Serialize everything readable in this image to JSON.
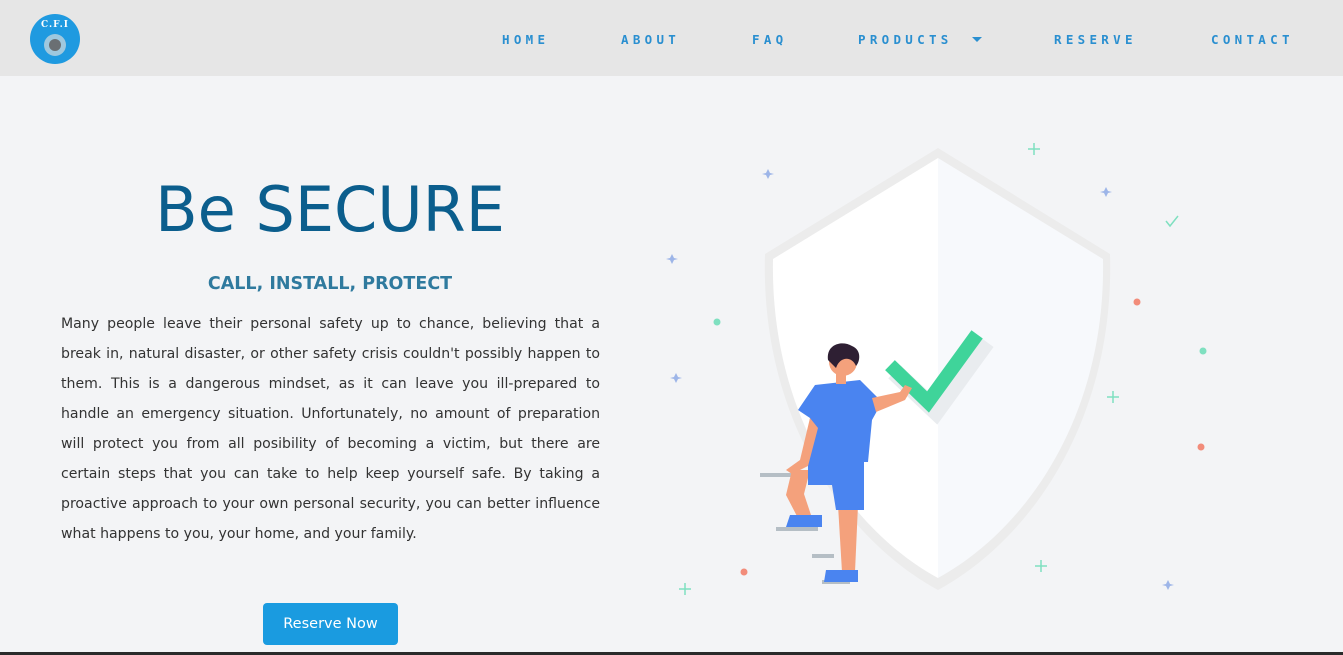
{
  "logo": {
    "text": "C.F.I"
  },
  "nav": {
    "home": "HOME",
    "about": "ABOUT",
    "faq": "FAQ",
    "products": "PRODUCTS",
    "reserve": "RESERVE",
    "contact": "CONTACT"
  },
  "hero": {
    "title": "Be SECURE",
    "subtitle": "CALL, INSTALL, PROTECT",
    "body": "Many people leave their personal safety up to chance, believing that a break in, natural disaster, or other safety crisis couldn't possibly happen to them. This is a dangerous mindset, as it can leave you ill-prepared to handle an emergency situation. Unfortunately, no amount of preparation will protect you from all posibility of becoming a victim, but there are certain steps that you can take to help keep yourself safe. By taking a proactive approach to your own personal security, you can better influence what happens to you, your home, and your family.",
    "cta": "Reserve Now"
  },
  "colors": {
    "accent": "#1a9be0",
    "title": "#0b5e8d",
    "nav": "#2a8fd0",
    "check": "#3fd49a",
    "person": "#4a84f0"
  },
  "icons": {
    "illustration": "security-shield-illustration"
  }
}
